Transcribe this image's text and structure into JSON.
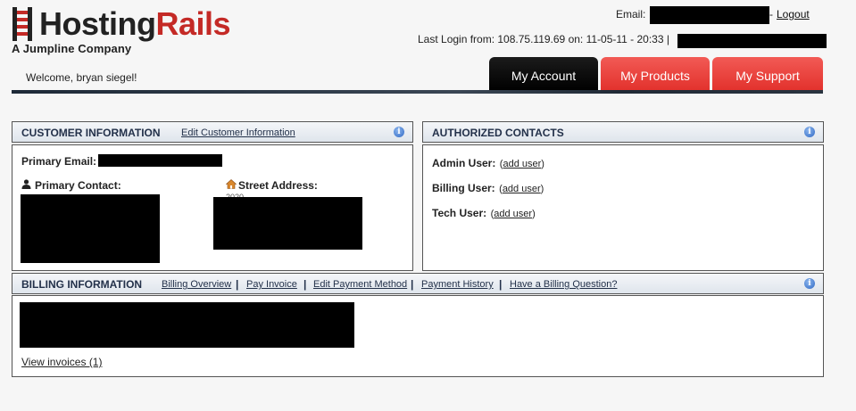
{
  "logo": {
    "name_part1": "Hosting",
    "name_part2": "Rails",
    "tagline": "A Jumpline Company"
  },
  "header": {
    "email_label": "Email:",
    "dash": "-",
    "logout_label": "Logout",
    "last_login_text": "Last Login from: 108.75.119.69 on: 11-05-11 - 20:33 |",
    "welcome": "Welcome, bryan siegel!"
  },
  "nav": {
    "tabs": [
      {
        "label": "My Account",
        "active": true
      },
      {
        "label": "My Products",
        "active": false
      },
      {
        "label": "My Support",
        "active": false
      }
    ]
  },
  "customer_info": {
    "title": "CUSTOMER INFORMATION",
    "edit_link": "Edit Customer Information",
    "primary_email_label": "Primary Email:",
    "primary_contact_label": "Primary Contact:",
    "street_address_label": "Street Address:",
    "street_address_partial": "2020"
  },
  "authorized_contacts": {
    "title": "AUTHORIZED CONTACTS",
    "rows": [
      {
        "label": "Admin User:",
        "open": "(",
        "link": "add user",
        "close": ")"
      },
      {
        "label": "Billing User:",
        "open": "(",
        "link": "add user",
        "close": ")"
      },
      {
        "label": "Tech User:",
        "open": "(",
        "link": "add user",
        "close": ")"
      }
    ]
  },
  "billing": {
    "title": "BILLING INFORMATION",
    "links": [
      "Billing Overview",
      "Pay Invoice",
      "Edit Payment Method",
      "Payment History",
      "Have a Billing Question?"
    ],
    "separator": "|",
    "view_invoices": "View invoices (1)"
  },
  "colors": {
    "brand_red": "#e2312c",
    "tab_active": "#000000",
    "panel_title": "#23314a"
  },
  "icons": [
    "info-icon",
    "user-icon",
    "home-icon",
    "ladder-logo-icon"
  ]
}
